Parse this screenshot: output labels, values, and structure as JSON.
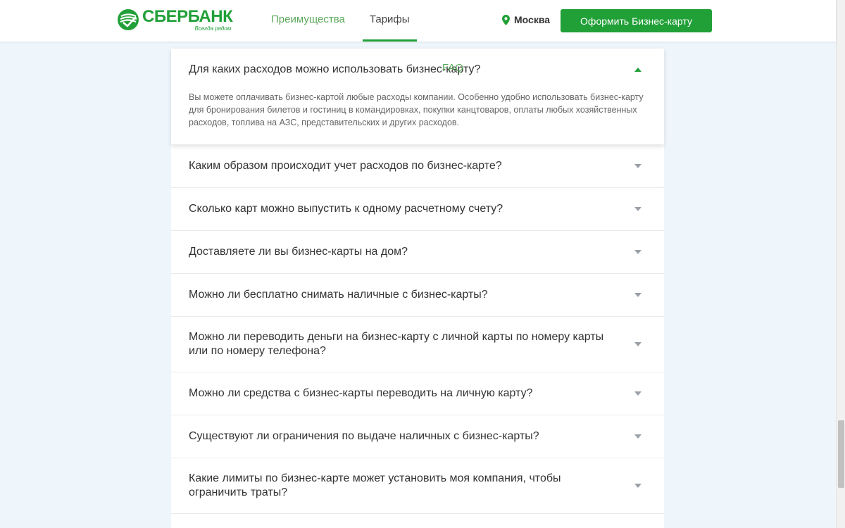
{
  "header": {
    "logo_name": "СБЕРБАНК",
    "logo_slogan": "Всегда рядом",
    "nav": [
      {
        "label": "Преимущества"
      },
      {
        "label": "Тарифы"
      },
      {
        "label": "FAQ"
      }
    ],
    "city": "Москва",
    "cta_label": "Оформить Бизнес-карту",
    "brand_color": "#21a038"
  },
  "faq": {
    "open": {
      "question": "Для каких расходов можно использовать бизнес-карту?",
      "answer": "Вы можете оплачивать бизнес-картой любые расходы компании. Особенно удобно использовать бизнес-карту для бронирования билетов и гостиниц в командировках, покупки канцтоваров, оплаты любых хозяйственных расходов, топлива на АЗС, представительских и других расходов."
    },
    "items": [
      {
        "question": "Каким образом происходит учет расходов по бизнес-карте?"
      },
      {
        "question": "Сколько карт можно выпустить к одному расчетному счету?"
      },
      {
        "question": "Доставляете ли вы бизнес-карты на дом?"
      },
      {
        "question": "Можно ли бесплатно снимать наличные с бизнес-карты?"
      },
      {
        "question": "Можно ли переводить деньги на бизнес-карту с личной карты по номеру карты или по номеру телефона?"
      },
      {
        "question": "Можно ли средства с бизнес-карты переводить на личную карту?"
      },
      {
        "question": "Существуют ли ограничения по выдаче наличных с бизнес-карты?"
      },
      {
        "question": "Какие лимиты по бизнес-карте может установить моя компания, чтобы ограничить траты?"
      }
    ]
  }
}
